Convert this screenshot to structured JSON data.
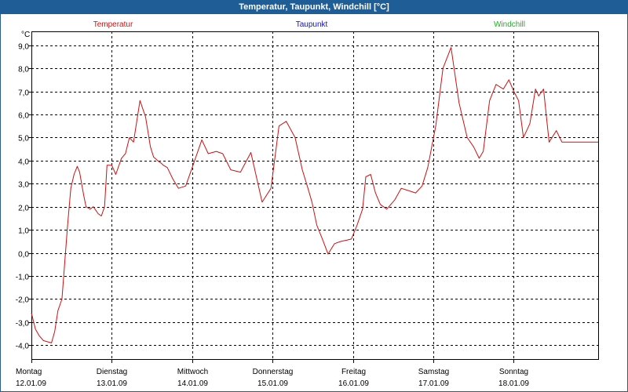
{
  "window": {
    "title": "Temperatur, Taupunkt, Windchill [°C]"
  },
  "legend": [
    {
      "label": "Temperatur",
      "color": "#d01010"
    },
    {
      "label": "Taupunkt",
      "color": "#1010c8"
    },
    {
      "label": "Windchill",
      "color": "#20b020"
    }
  ],
  "chart_data": {
    "type": "line",
    "title": "Temperatur, Taupunkt, Windchill [°C]",
    "ylabel": "°C",
    "ylim": [
      -4.6,
      9.6
    ],
    "yticks": [
      "9,0",
      "8,0",
      "7,0",
      "6,0",
      "5,0",
      "4,0",
      "3,0",
      "2,0",
      "1,0",
      "0,0",
      "-1,0",
      "-2,0",
      "-3,0",
      "-4,0"
    ],
    "ytick_values": [
      9,
      8,
      7,
      6,
      5,
      4,
      3,
      2,
      1,
      0,
      -1,
      -2,
      -3,
      -4
    ],
    "xlim": [
      0,
      7.05
    ],
    "day_labels": [
      {
        "day": "Montag",
        "date": "12.01.09"
      },
      {
        "day": "Dienstag",
        "date": "13.01.09"
      },
      {
        "day": "Mittwoch",
        "date": "14.01.09"
      },
      {
        "day": "Donnerstag",
        "date": "15.01.09"
      },
      {
        "day": "Freitag",
        "date": "16.01.09"
      },
      {
        "day": "Samstag",
        "date": "17.01.09"
      },
      {
        "day": "Sonntag",
        "date": "18.01.09"
      }
    ],
    "grid": true,
    "legend_position": "top",
    "series": [
      {
        "name": "Temperatur",
        "color": "#d01010",
        "x": [
          0,
          0.05,
          0.1,
          0.15,
          0.2,
          0.25,
          0.29,
          0.33,
          0.38,
          0.45,
          0.49,
          0.53,
          0.57,
          0.6,
          0.65,
          0.68,
          0.73,
          0.77,
          0.83,
          0.87,
          0.91,
          0.94,
          1.0,
          1.05,
          1.12,
          1.17,
          1.22,
          1.27,
          1.35,
          1.42,
          1.48,
          1.52,
          1.57,
          1.61,
          1.64,
          1.69,
          1.76,
          1.83,
          1.92,
          2.02,
          2.12,
          2.2,
          2.3,
          2.38,
          2.48,
          2.6,
          2.73,
          2.87,
          2.98,
          3.08,
          3.17,
          3.28,
          3.37,
          3.44,
          3.49,
          3.55,
          3.62,
          3.69,
          3.77,
          3.85,
          3.92,
          3.98,
          4.05,
          4.12,
          4.16,
          4.22,
          4.28,
          4.34,
          4.42,
          4.52,
          4.6,
          4.69,
          4.78,
          4.86,
          4.93,
          5.03,
          5.12,
          5.22,
          5.32,
          5.42,
          5.5,
          5.57,
          5.62,
          5.7,
          5.78,
          5.87,
          5.94,
          6.0,
          6.06,
          6.12,
          6.2,
          6.27,
          6.31,
          6.37,
          6.44,
          6.53,
          6.6,
          6.66,
          6.73,
          6.78,
          6.83,
          6.86,
          6.88,
          6.92,
          6.96,
          7.0,
          7.05
        ],
        "y": [
          -2.6,
          -3.3,
          -3.6,
          -3.8,
          -3.85,
          -3.9,
          -3.4,
          -2.5,
          -2.0,
          1.2,
          2.8,
          3.4,
          3.75,
          3.5,
          2.5,
          2.0,
          1.9,
          2.0,
          1.7,
          1.6,
          2.0,
          3.8,
          3.8,
          3.4,
          4.1,
          4.3,
          5.0,
          4.8,
          6.6,
          5.9,
          4.6,
          4.15,
          4.0,
          3.9,
          3.8,
          3.7,
          3.2,
          2.8,
          2.9,
          3.9,
          4.9,
          4.3,
          4.4,
          4.3,
          3.6,
          3.5,
          4.35,
          2.2,
          2.8,
          5.5,
          5.7,
          5.0,
          3.6,
          2.8,
          2.2,
          1.2,
          0.6,
          -0.05,
          0.4,
          0.5,
          0.55,
          0.6,
          1.2,
          1.9,
          3.3,
          3.4,
          2.6,
          2.1,
          1.9,
          2.3,
          2.8,
          2.7,
          2.6,
          2.9,
          3.7,
          5.5,
          8.0,
          8.9,
          6.5,
          5.0,
          4.6,
          4.1,
          4.4,
          6.6,
          7.3,
          7.1,
          7.5,
          7.0,
          6.6,
          5.0,
          5.6,
          7.1,
          6.8,
          7.1,
          4.8,
          5.3,
          4.8,
          4.8,
          4.8,
          4.8,
          4.8,
          4.8,
          4.8,
          4.8,
          4.8,
          4.8,
          4.8
        ]
      }
    ]
  }
}
